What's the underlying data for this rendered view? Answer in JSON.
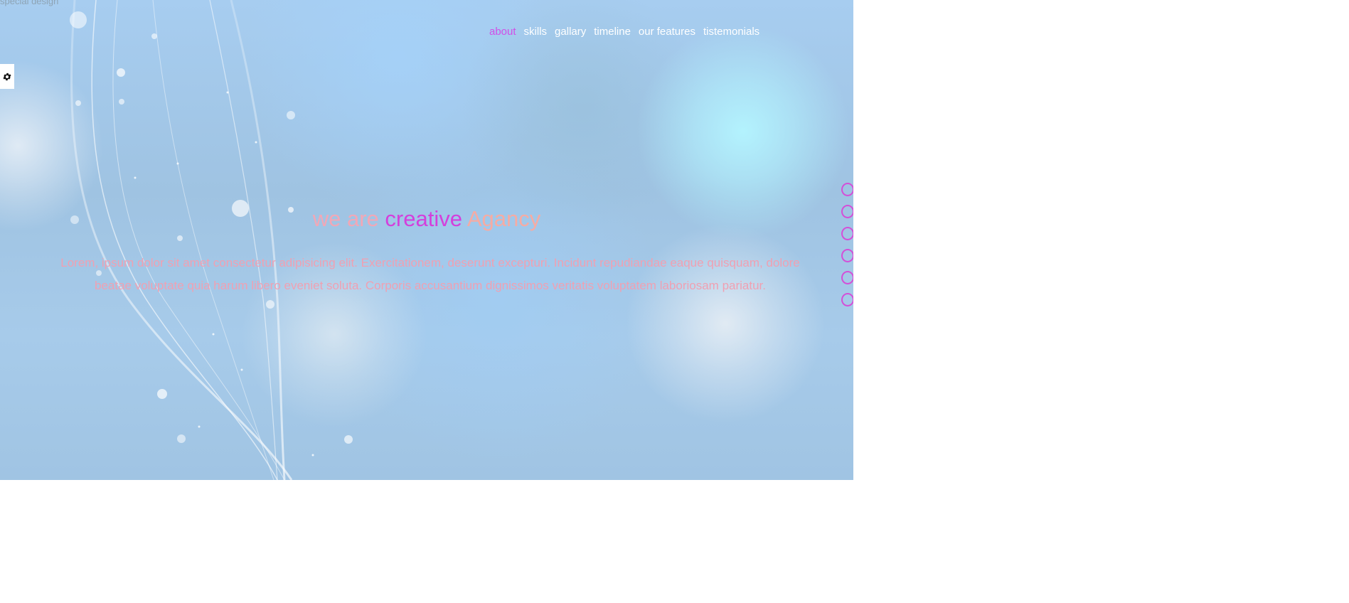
{
  "page": {
    "caption": "special design"
  },
  "nav": {
    "items": [
      {
        "label": "about",
        "active": true
      },
      {
        "label": "skills"
      },
      {
        "label": "gallary"
      },
      {
        "label": "timeline"
      },
      {
        "label": "our features"
      },
      {
        "label": "tistemonials"
      }
    ]
  },
  "settings": {
    "icon": "gear-icon"
  },
  "hero": {
    "title_pre": "we are",
    "title_em": "creative",
    "title_post": "Agancy",
    "lead": "Lorem, ipsum dolor sit amet consectetur adipisicing elit. Exercitationem, deserunt excepturi. Incidunt repudiandae eaque quisquam, dolore beatae voluptate quia harum libero eveniet soluta. Corporis accusantium dignissimos veritatis voluptatem laboriosam pariatur."
  },
  "bullets": {
    "count": 6
  },
  "colors": {
    "accent": "#d14fe8",
    "nav_text": "#ffffff",
    "title_soft": "#f2a7b6",
    "lead_text": "#f0a0b2"
  }
}
